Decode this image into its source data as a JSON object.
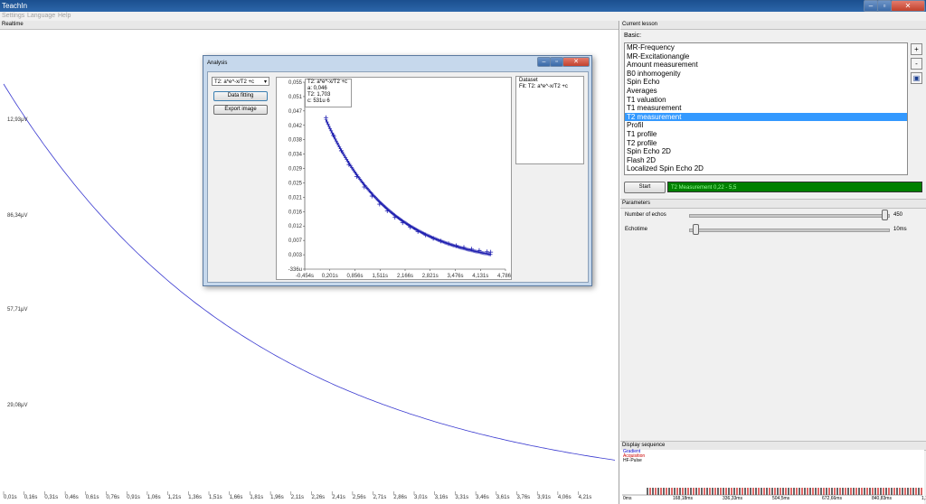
{
  "app": {
    "title": "TeachIn",
    "menu": [
      "Settings",
      "Language",
      "Help"
    ]
  },
  "plot": {
    "header": "Realtime",
    "y_labels": [
      "12,93μV",
      "86,34μV",
      "57,71μV",
      "29,08μV"
    ],
    "x_labels": [
      "0,01s",
      "0,16s",
      "0,31s",
      "0,46s",
      "0,61s",
      "0,76s",
      "0,91s",
      "1,06s",
      "1,21s",
      "1,36s",
      "1,51s",
      "1,66s",
      "1,81s",
      "1,96s",
      "2,11s",
      "2,26s",
      "2,41s",
      "2,56s",
      "2,71s",
      "2,86s",
      "3,01s",
      "3,16s",
      "3,31s",
      "3,46s",
      "3,61s",
      "3,76s",
      "3,91s",
      "4,06s",
      "4,21s"
    ],
    "curve_color": "#3a3ad0"
  },
  "lesson": {
    "header": "Current lesson",
    "basic_label": "Basic:",
    "items": [
      "MR-Frequency",
      "MR-Excitationangle",
      "Amount measurement",
      "B0 inhomogenity",
      "Spin Echo",
      "Averages",
      "T1 valuation",
      "T1 measurement",
      "T2 measurement",
      "Profil",
      "T1 profile",
      "T2 profile",
      "Spin Echo 2D",
      "Flash 2D",
      "Localized Spin Echo 2D"
    ],
    "selected_index": 8,
    "side_buttons": [
      "+",
      "-"
    ],
    "start_label": "Start",
    "status_text": "T2 Measurement 0,22 - 5,5",
    "status_color": "#008000"
  },
  "parameters": {
    "header": "Parameters",
    "items": [
      {
        "label": "Number of echos",
        "value": "450",
        "fraction": 0.98
      },
      {
        "label": "Echotime",
        "value": "10ms",
        "fraction": 0.03
      }
    ]
  },
  "sequence": {
    "header": "Display sequence",
    "legend": [
      {
        "label": "Gradient",
        "color": "#0000cc"
      },
      {
        "label": "Acquisition",
        "color": "#cc0000"
      },
      {
        "label": "HF-Pulse",
        "color": "#000000"
      }
    ],
    "axis": [
      "0ms",
      "168,18ms",
      "336,33ms",
      "504,5ms",
      "672,66ms",
      "840,83ms",
      "1,125ms"
    ]
  },
  "analysis": {
    "title": "Analysis",
    "fit_select": "T2: a*e^-x/T2 +c",
    "data_fitting_label": "Data fitting",
    "export_label": "Export image",
    "fit_info": [
      "T2: a*e^-x/T2 +c",
      "a: 0,046",
      "T2: 1,703",
      "c: 531u 6"
    ],
    "dataset_title": "Dataset",
    "dataset_line": "Fit: T2: a*e^-x/T2 +c",
    "marker_color": "#2020b0"
  },
  "chart_data": {
    "type": "scatter",
    "title": "",
    "xlabel": "",
    "ylabel": "",
    "x_ticks": [
      "-0,454s",
      "0,201s",
      "0,856s",
      "1,511s",
      "2,166s",
      "2,821s",
      "3,476s",
      "4,131s",
      "4,786s"
    ],
    "y_ticks": [
      "-336u",
      "0,003",
      "0,007",
      "0,012",
      "0,016",
      "0,021",
      "0,025",
      "0,029",
      "0,034",
      "0,038",
      "0,042",
      "0,047",
      "0,051",
      "0,055"
    ],
    "xlim": [
      -0.454,
      4.786
    ],
    "ylim": [
      -0.000336,
      0.055
    ],
    "fit": {
      "a": 0.046,
      "T2": 1.703,
      "c": 0.000531
    },
    "x_range": [
      0.1,
      4.4
    ],
    "series": [
      {
        "x": [
          0.1,
          0.3,
          0.5,
          0.7,
          0.9,
          1.1,
          1.3,
          1.5,
          1.7,
          1.9,
          2.1,
          2.3,
          2.5,
          2.7,
          2.9,
          3.1,
          3.3,
          3.5,
          3.7,
          3.9,
          4.1,
          4.3,
          4.4
        ],
        "y": [
          0.0445,
          0.0392,
          0.0347,
          0.0306,
          0.0271,
          0.024,
          0.0213,
          0.0189,
          0.0169,
          0.015,
          0.0134,
          0.0121,
          0.0108,
          0.0098,
          0.0088,
          0.008,
          0.0072,
          0.0066,
          0.0061,
          0.0056,
          0.0052,
          0.0048,
          0.0047
        ]
      }
    ]
  }
}
